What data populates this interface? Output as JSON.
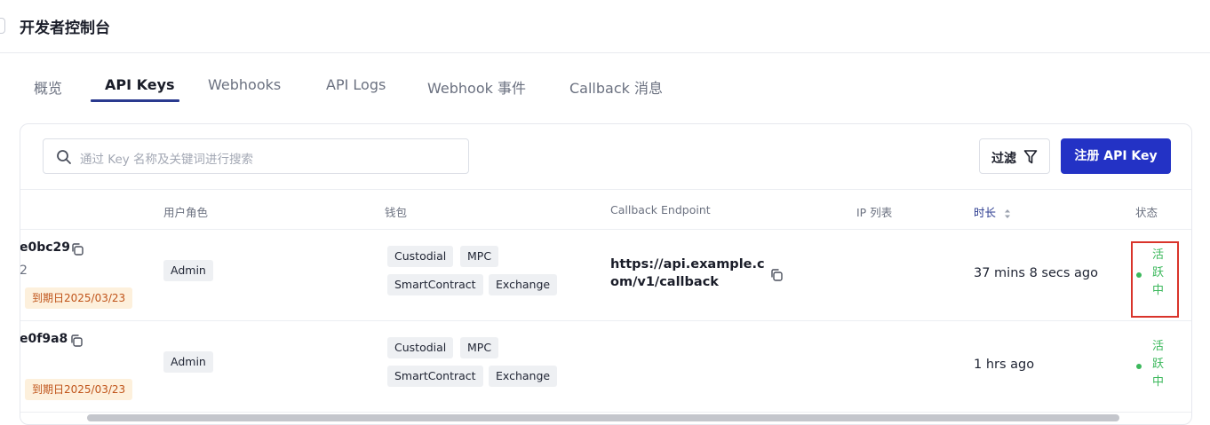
{
  "header": {
    "title": "开发者控制台"
  },
  "tabs": [
    {
      "label": "概览"
    },
    {
      "label": "API Keys"
    },
    {
      "label": "Webhooks"
    },
    {
      "label": "API Logs"
    },
    {
      "label": "Webhook 事件"
    },
    {
      "label": "Callback 消息"
    }
  ],
  "active_tab": "API Keys",
  "toolbar": {
    "search_placeholder": "通过 Key 名称及关键词进行搜索",
    "filter_label": "过滤",
    "register_label": "注册 API Key"
  },
  "table": {
    "columns": {
      "role": "用户角色",
      "wallet": "钱包",
      "callback": "Callback Endpoint",
      "ip": "IP 列表",
      "duration": "时长",
      "status": "状态"
    },
    "rows": [
      {
        "key": "e0bc29",
        "sub": "2",
        "expiry": "到期日2025/03/23",
        "role": "Admin",
        "wallets": [
          "Custodial",
          "MPC",
          "SmartContract",
          "Exchange"
        ],
        "callback": "https://api.example.com/v1/callback",
        "duration": "37 mins 8 secs ago",
        "status": [
          "活",
          "跃",
          "中"
        ]
      },
      {
        "key": "e0f9a8",
        "sub": "",
        "expiry": "到期日2025/03/23",
        "role": "Admin",
        "wallets": [
          "Custodial",
          "MPC",
          "SmartContract",
          "Exchange"
        ],
        "callback": "",
        "duration": "1 hrs ago",
        "status": [
          "活",
          "跃",
          "中"
        ]
      }
    ]
  },
  "colors": {
    "primary": "#2332c5",
    "active_tab_underline": "#2a3a8f",
    "status_active": "#3cb85c",
    "expiry_bg": "#fdf0dc",
    "expiry_text": "#c0541a",
    "highlight": "#d9342b"
  }
}
